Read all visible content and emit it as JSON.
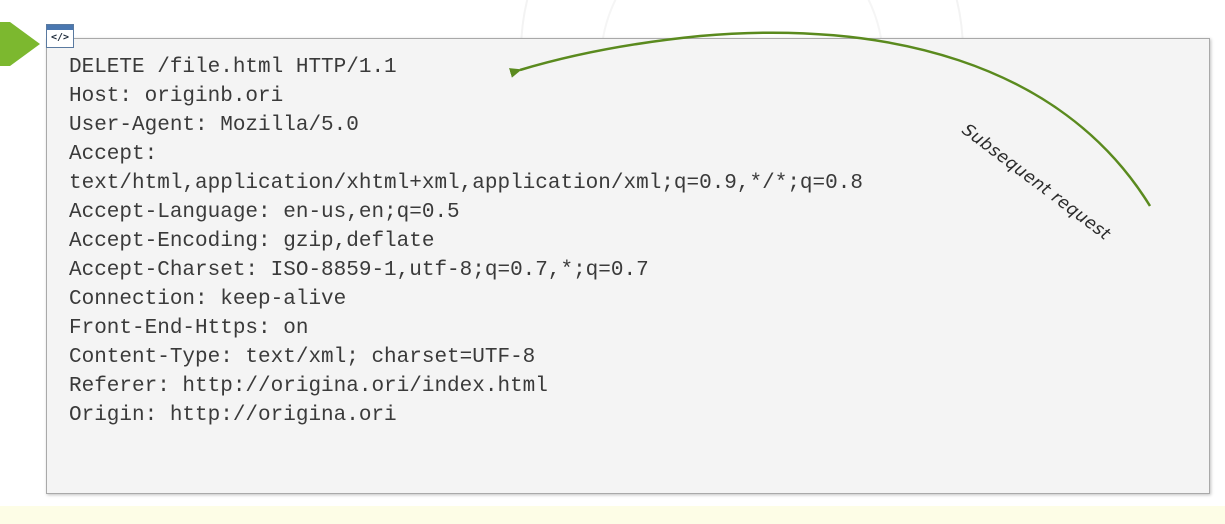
{
  "icon": {
    "name": "code-icon",
    "glyph": "</>"
  },
  "request_lines": [
    "DELETE /file.html HTTP/1.1",
    "Host: originb.ori",
    "User-Agent: Mozilla/5.0",
    "Accept:",
    "text/html,application/xhtml+xml,application/xml;q=0.9,*/*;q=0.8",
    "Accept-Language: en-us,en;q=0.5",
    "Accept-Encoding: gzip,deflate",
    "Accept-Charset: ISO-8859-1,utf-8;q=0.7,*;q=0.7",
    "Connection: keep-alive",
    "Front-End-Https: on",
    "Content-Type: text/xml; charset=UTF-8",
    "Referer: http://origina.ori/index.html",
    "Origin: http://origina.ori"
  ],
  "annotation": {
    "label": "Subsequent request"
  },
  "colors": {
    "accent_green": "#7cb82f",
    "arrow_green": "#5a8a1e",
    "panel_bg": "#f4f4f4",
    "text": "#3a3a3a"
  }
}
